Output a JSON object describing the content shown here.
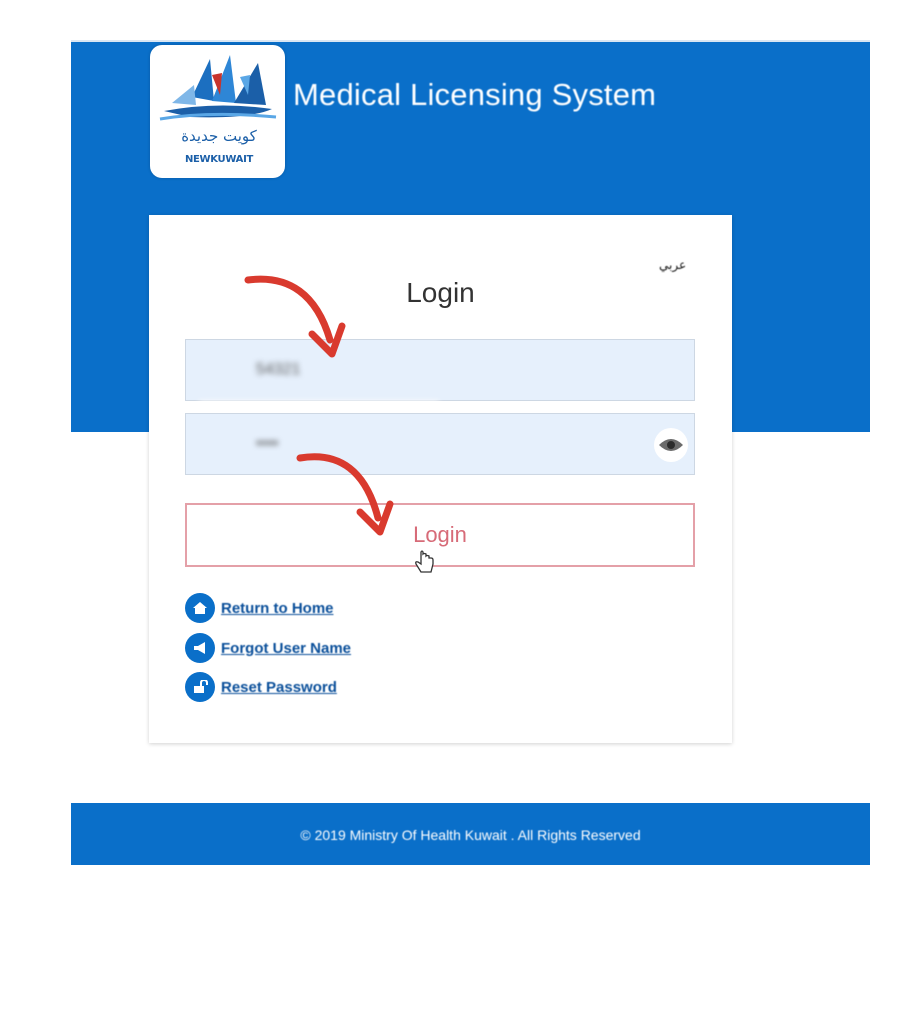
{
  "header": {
    "title": "Medical Licensing System",
    "logo_arabic": "كويت جديدة",
    "logo_english": "NEWKUWAIT"
  },
  "login_card": {
    "language_link": "عربي",
    "title": "Login",
    "username_value": "54321",
    "password_value": "••••",
    "login_button": "Login",
    "links": [
      {
        "label": "Return to Home",
        "icon": "home-icon"
      },
      {
        "label": "Forgot User Name",
        "icon": "megaphone-icon"
      },
      {
        "label": "Reset Password",
        "icon": "lock-icon"
      }
    ]
  },
  "footer": {
    "text": "© 2019 Ministry Of Health Kuwait . All Rights Reserved"
  },
  "colors": {
    "brand_blue": "#0a6fc9",
    "field_bg": "#e6f0fc",
    "login_border": "#e4a0a8",
    "arrow_red": "#d93a2e"
  }
}
